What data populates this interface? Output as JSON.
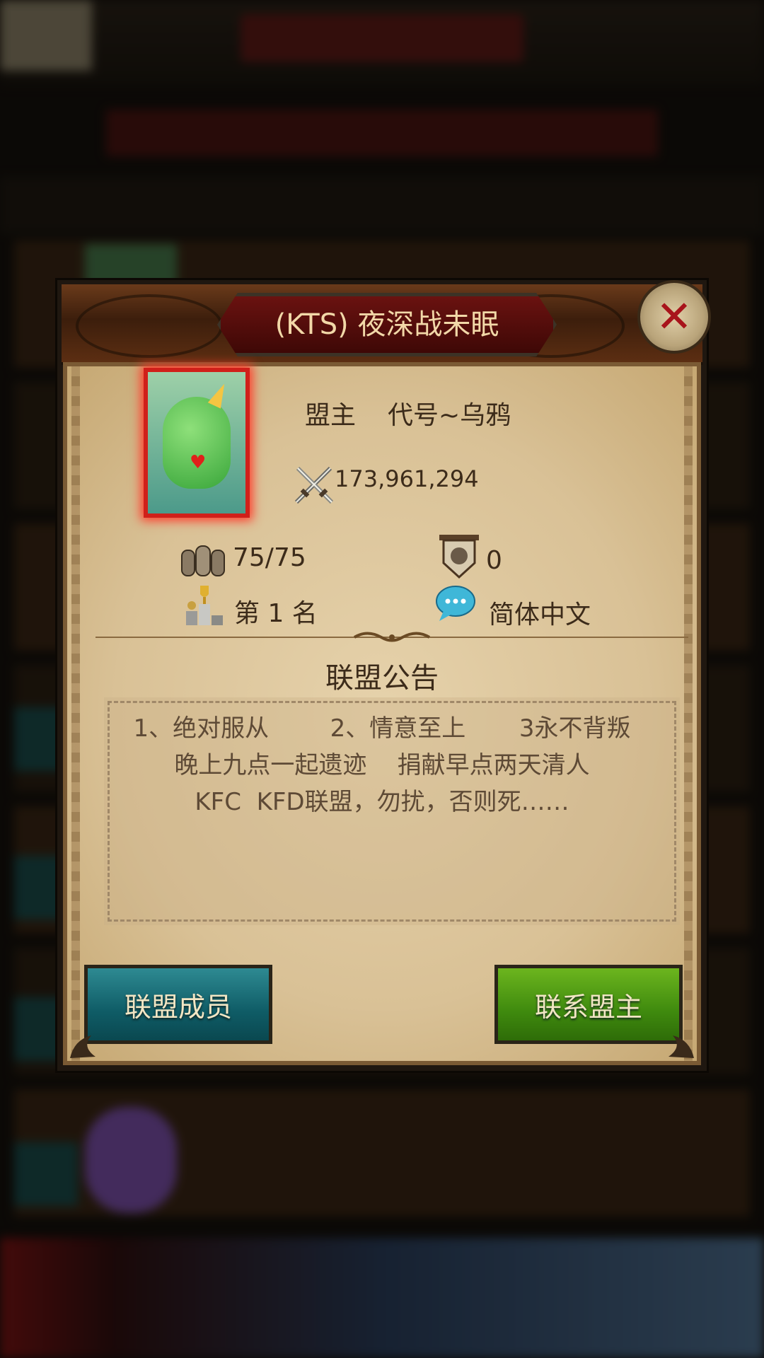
{
  "dialog": {
    "title": "(KTS) 夜深战未眠",
    "close_icon": "close-x-icon"
  },
  "leader": {
    "label": "盟主",
    "name": "代号~乌鸦",
    "avatar_icon": "green-unicorn-dinosaur-avatar",
    "power_icon": "crossed-swords-icon",
    "power": "173,961,294"
  },
  "stats": {
    "members_icon": "members-icon",
    "members": "75/75",
    "fortress_icon": "fortress-shield-icon",
    "fortress": "0",
    "rank_icon": "trophy-podium-icon",
    "rank": "第 1 名",
    "language_icon": "speech-bubble-icon",
    "language": "简体中文"
  },
  "notice": {
    "title": "联盟公告",
    "lines": [
      "1、绝对服从        2、情意至上       3永不背叛",
      "晚上九点一起遗迹    捐献早点两天清人",
      "KFC  KFD联盟，勿扰，否则死……"
    ]
  },
  "buttons": {
    "members": "联盟成员",
    "contact": "联系盟主"
  },
  "colors": {
    "members_button": "#13707a",
    "contact_button": "#4f9a12",
    "parchment": "#dcc59a",
    "title_plate": "#5e0f0c"
  }
}
